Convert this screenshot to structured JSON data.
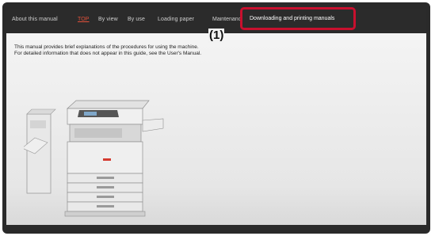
{
  "nav": {
    "items": [
      "About this manual",
      "TOP",
      "By view",
      "By use",
      "Loading paper"
    ],
    "maintenance": "Maintenance",
    "downloads": "Downloading and printing manuals"
  },
  "callout": "(1)",
  "intro": {
    "line1": "This manual provides brief explanations of the procedures for using the machine.",
    "line2": "For detailed information that does not appear in this guide, see the User's Manual."
  },
  "illustration": {
    "icon": "multifunction-copier-image"
  }
}
